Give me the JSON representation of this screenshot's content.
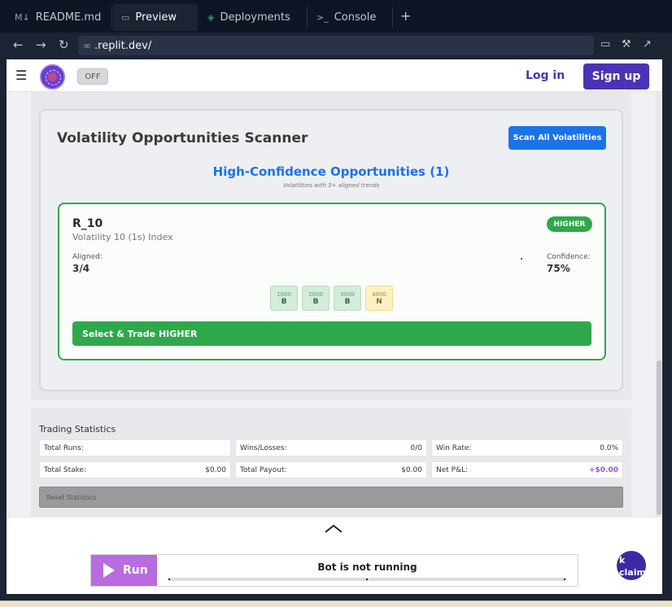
{
  "tabs": [
    {
      "icon": "markdown-icon",
      "label": "README.md"
    },
    {
      "icon": "preview-icon",
      "label": "Preview"
    },
    {
      "icon": "deployments-icon",
      "label": "Deployments"
    },
    {
      "icon": "console-icon",
      "label": "Console"
    }
  ],
  "urlbar": {
    "url": ".replit.dev/"
  },
  "app": {
    "toggle_label": "OFF",
    "login_label": "Log in",
    "signup_label": "Sign up"
  },
  "scanner": {
    "title": "Volatility Opportunities Scanner",
    "scan_button": "Scan All Volatilities",
    "high_conf_title": "High-Confidence Opportunities (1)",
    "high_conf_subtitle": "Volatilities with 3+ aligned trends",
    "opportunity": {
      "symbol": "R_10",
      "name": "Volatility 10 (1s) Index",
      "direction": "HIGHER",
      "aligned_label": "Aligned:",
      "aligned_value": "3/4",
      "confidence_label": "Confidence:",
      "confidence_value": "75%",
      "timeframes": [
        {
          "period": "1000",
          "signal": "B"
        },
        {
          "period": "2000",
          "signal": "B"
        },
        {
          "period": "3000",
          "signal": "B"
        },
        {
          "period": "4000",
          "signal": "N"
        }
      ],
      "trade_button": "Select & Trade HIGHER"
    }
  },
  "stats": {
    "title": "Trading Statistics",
    "items": [
      {
        "label": "Total Runs:",
        "value": ""
      },
      {
        "label": "Wins/Losses:",
        "value": "0/0"
      },
      {
        "label": "Win Rate:",
        "value": "0.0%"
      },
      {
        "label": "Total Stake:",
        "value": "$0.00"
      },
      {
        "label": "Total Payout:",
        "value": "$0.00"
      },
      {
        "label": "Net P&L:",
        "value": "+$0.00"
      }
    ],
    "reset_button": "Reset Statistics"
  },
  "runbar": {
    "run_label": "Run",
    "status": "Bot is not running",
    "chat_line1": "k",
    "chat_line2": "claim"
  },
  "colors": {
    "accent_blue": "#1a73e8",
    "success_green": "#2ea84a",
    "brand_purple": "#4b33b5",
    "run_purple": "#b86ce0",
    "pnl_purple": "#a64ed4"
  }
}
